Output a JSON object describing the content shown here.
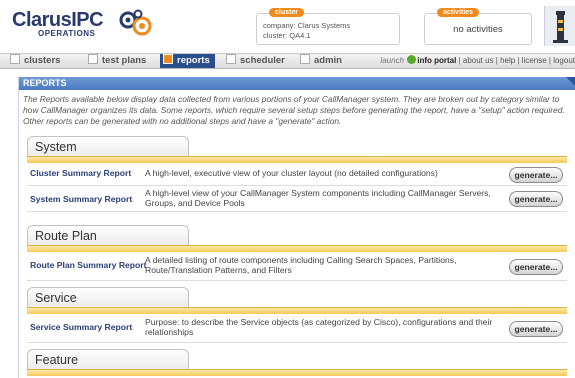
{
  "header": {
    "logo_main": "ClarusIPC",
    "logo_sub": "OPERATIONS",
    "cluster": {
      "badge": "cluster",
      "company": "company: Clarus Systems",
      "name": "cluster: QA4.1"
    },
    "activities": {
      "badge": "activities",
      "text": "no activities"
    }
  },
  "nav": {
    "tabs": [
      {
        "label": "clusters"
      },
      {
        "label": "test plans"
      },
      {
        "label": "reports"
      },
      {
        "label": "scheduler"
      },
      {
        "label": "admin"
      }
    ],
    "active_tab": "reports",
    "launch_label": "launch",
    "portal_label": "info portal",
    "links": [
      "about us",
      "help",
      "license",
      "logout"
    ]
  },
  "reports": {
    "title": "REPORTS",
    "description": "The Reports available below display data collected from various portions of your CallManager system. They are broken out by category similar to how CallManager organizes its data. Some reports, which require several setup steps before generating the report, have a \"setup\" action required. Other reports can be generated with no additional steps and have a \"generate\" action.",
    "button_label": "generate...",
    "sections": [
      {
        "title": "System",
        "items": [
          {
            "name": "Cluster Summary Report",
            "desc": "A high-level, executive view of your cluster layout (no detailed configurations)"
          },
          {
            "name": "System Summary Report",
            "desc": "A high-level view of your CallManager System components including CallManager Servers, Groups, and Device Pools"
          }
        ]
      },
      {
        "title": "Route Plan",
        "items": [
          {
            "name": "Route Plan Summary Report",
            "desc": "A detailed listing of route components including Calling Search Spaces, Partitions, Route/Translation Patterns, and Filters"
          }
        ]
      },
      {
        "title": "Service",
        "items": [
          {
            "name": "Service Summary Report",
            "desc": "Purpose: to describe the Service objects (as categorized by Cisco), configurations and their relationships"
          }
        ]
      },
      {
        "title": "Feature",
        "items": []
      }
    ]
  },
  "colors": {
    "nav_active": "#2a4d8e",
    "accent_orange": "#f08a1c",
    "panel_header": "#5b86c8",
    "section_band": "#f5c95b"
  }
}
